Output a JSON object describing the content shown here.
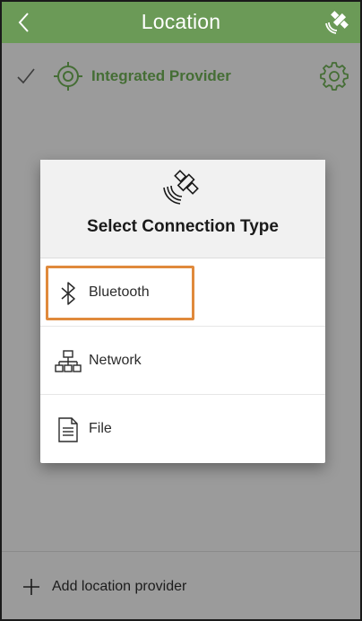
{
  "header": {
    "title": "Location",
    "back_icon": "chevron-left-icon",
    "status_icon": "satellite-icon"
  },
  "provider": {
    "name": "Integrated Provider",
    "check_icon": "checkmark-icon",
    "type_icon": "crosshair-target-icon",
    "settings_icon": "gear-icon"
  },
  "dialog": {
    "icon": "satellite-icon",
    "title": "Select Connection Type",
    "options": [
      {
        "label": "Bluetooth",
        "icon": "bluetooth-icon",
        "highlighted": true
      },
      {
        "label": "Network",
        "icon": "network-icon",
        "highlighted": false
      },
      {
        "label": "File",
        "icon": "file-icon",
        "highlighted": false
      }
    ]
  },
  "footer": {
    "add_label": "Add location provider",
    "add_icon": "plus-icon"
  },
  "colors": {
    "header_bg": "#6b9a57",
    "provider_text": "#456e35",
    "overlay_bg": "#9b9b9b",
    "highlight_border": "#e08a3c"
  }
}
